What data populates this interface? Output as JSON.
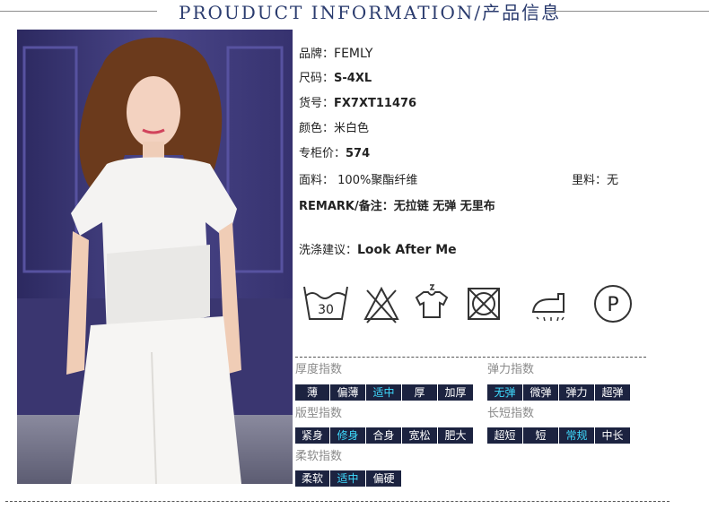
{
  "header": {
    "title": "PROUDUCT INFORMATION/产品信息"
  },
  "product": {
    "brand_label": "品牌：",
    "brand": "FEMLY",
    "size_label": "尺码：",
    "size": "S-4XL",
    "sku_label": "货号：",
    "sku": "FX7XT11476",
    "color_label": "颜色：",
    "color": "米白色",
    "price_label": "专柜价：",
    "price": "574",
    "fabric_label": "面料：",
    "fabric": "100%聚酯纤维",
    "lining_label": "里料：",
    "lining": "无",
    "remark_label": "REMARK/备注：",
    "remark": "无拉链 无弹 无里布",
    "wash_label": "洗涤建议：",
    "wash": "Look After Me"
  },
  "care_icons": {
    "wash_temp": "30",
    "names": [
      "wash-30-icon",
      "no-bleach-icon",
      "hang-dry-icon",
      "no-tumble-dry-icon",
      "steam-iron-icon",
      "professional-clean-icon"
    ],
    "dry_clean_letter": "P"
  },
  "indices": {
    "thickness": {
      "title": "厚度指数",
      "options": [
        "薄",
        "偏薄",
        "适中",
        "厚",
        "加厚"
      ],
      "selected": "适中"
    },
    "elasticity": {
      "title": "弹力指数",
      "options": [
        "无弹",
        "微弹",
        "弹力",
        "超弹"
      ],
      "selected": "无弹"
    },
    "fit": {
      "title": "版型指数",
      "options": [
        "紧身",
        "修身",
        "合身",
        "宽松",
        "肥大"
      ],
      "selected": "修身"
    },
    "length": {
      "title": "长短指数",
      "options": [
        "超短",
        "短",
        "常规",
        "中长"
      ],
      "selected": "常规"
    },
    "softness": {
      "title": "柔软指数",
      "options": [
        "柔软",
        "适中",
        "偏硬"
      ],
      "selected": "适中"
    }
  },
  "colors": {
    "tag_bg": "#1c2340",
    "tag_selected_text": "#3fdcff",
    "header_text": "#2a3b6e",
    "backdrop": "#3e3a78"
  }
}
